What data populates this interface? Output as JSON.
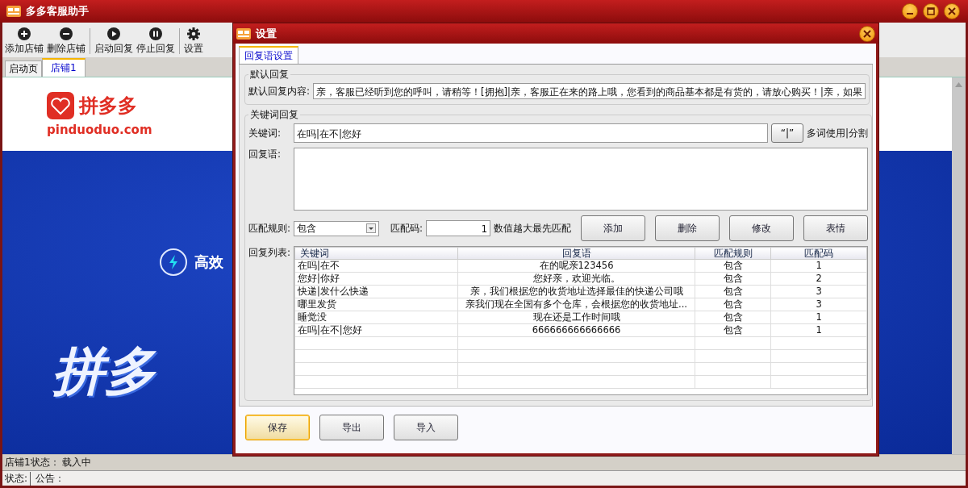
{
  "window": {
    "title": "多多客服助手"
  },
  "toolbar": [
    {
      "label": "添加店铺",
      "kind": "add"
    },
    {
      "label": "删除店铺",
      "kind": "remove"
    },
    {
      "label": "启动回复",
      "kind": "play"
    },
    {
      "label": "停止回复",
      "kind": "pause"
    },
    {
      "label": "设置",
      "kind": "settings"
    }
  ],
  "tabs": [
    {
      "label": "启动页",
      "selected": false
    },
    {
      "label": "店铺1",
      "selected": true
    }
  ],
  "page": {
    "logo_text": "拼多多",
    "logo_domain": "pinduoduo.com",
    "feature": "高效",
    "headline": "拼多"
  },
  "status_bar": {
    "shop_status": "店铺1状态： 载入中",
    "status_label": "状态:",
    "notice": "公告："
  },
  "dialog": {
    "title": "设置",
    "tabs": [
      {
        "label": "回复语设置",
        "selected": true
      }
    ],
    "default_reply": {
      "legend": "默认回复",
      "label": "默认回复内容:",
      "value": "亲，客服已经听到您的呼叫，请稍等！[拥抱]|亲，客服正在来的路上哦，您看到的商品基本都是有货的，请放心购买！|亲，如果"
    },
    "keyword_reply": {
      "legend": "关键词回复",
      "keyword_label": "关键词:",
      "keyword_value": "在吗|在不|您好",
      "separator_button": "“|”",
      "separator_hint": "多词使用|分割",
      "reply_label": "回复语:",
      "rule_label": "匹配规则:",
      "rule_value": "包含",
      "code_label": "匹配码:",
      "code_value": "1",
      "code_hint": "数值越大最先匹配",
      "buttons": [
        "添加",
        "删除",
        "修改",
        "表情"
      ],
      "list_label": "回复列表:",
      "table": {
        "columns": [
          "关键词",
          "回复语",
          "匹配规则",
          "匹配码"
        ],
        "rows": [
          [
            "在吗|在不",
            "在的呢亲123456",
            "包含",
            "1"
          ],
          [
            "您好|你好",
            "您好亲，欢迎光临。",
            "包含",
            "2"
          ],
          [
            "快递|发什么快递",
            "亲，我们根据您的收货地址选择最佳的快递公司哦",
            "包含",
            "3"
          ],
          [
            "哪里发货",
            "亲我们现在全国有多个仓库，会根据您的收货地址...",
            "包含",
            "3"
          ],
          [
            "睡觉没",
            "现在还是工作时间哦",
            "包含",
            "1"
          ],
          [
            "在吗|在不|您好",
            "666666666666666",
            "包含",
            "1"
          ]
        ]
      }
    },
    "footer_buttons": [
      {
        "label": "保存",
        "default": true
      },
      {
        "label": "导出",
        "default": false
      },
      {
        "label": "导入",
        "default": false
      }
    ]
  }
}
